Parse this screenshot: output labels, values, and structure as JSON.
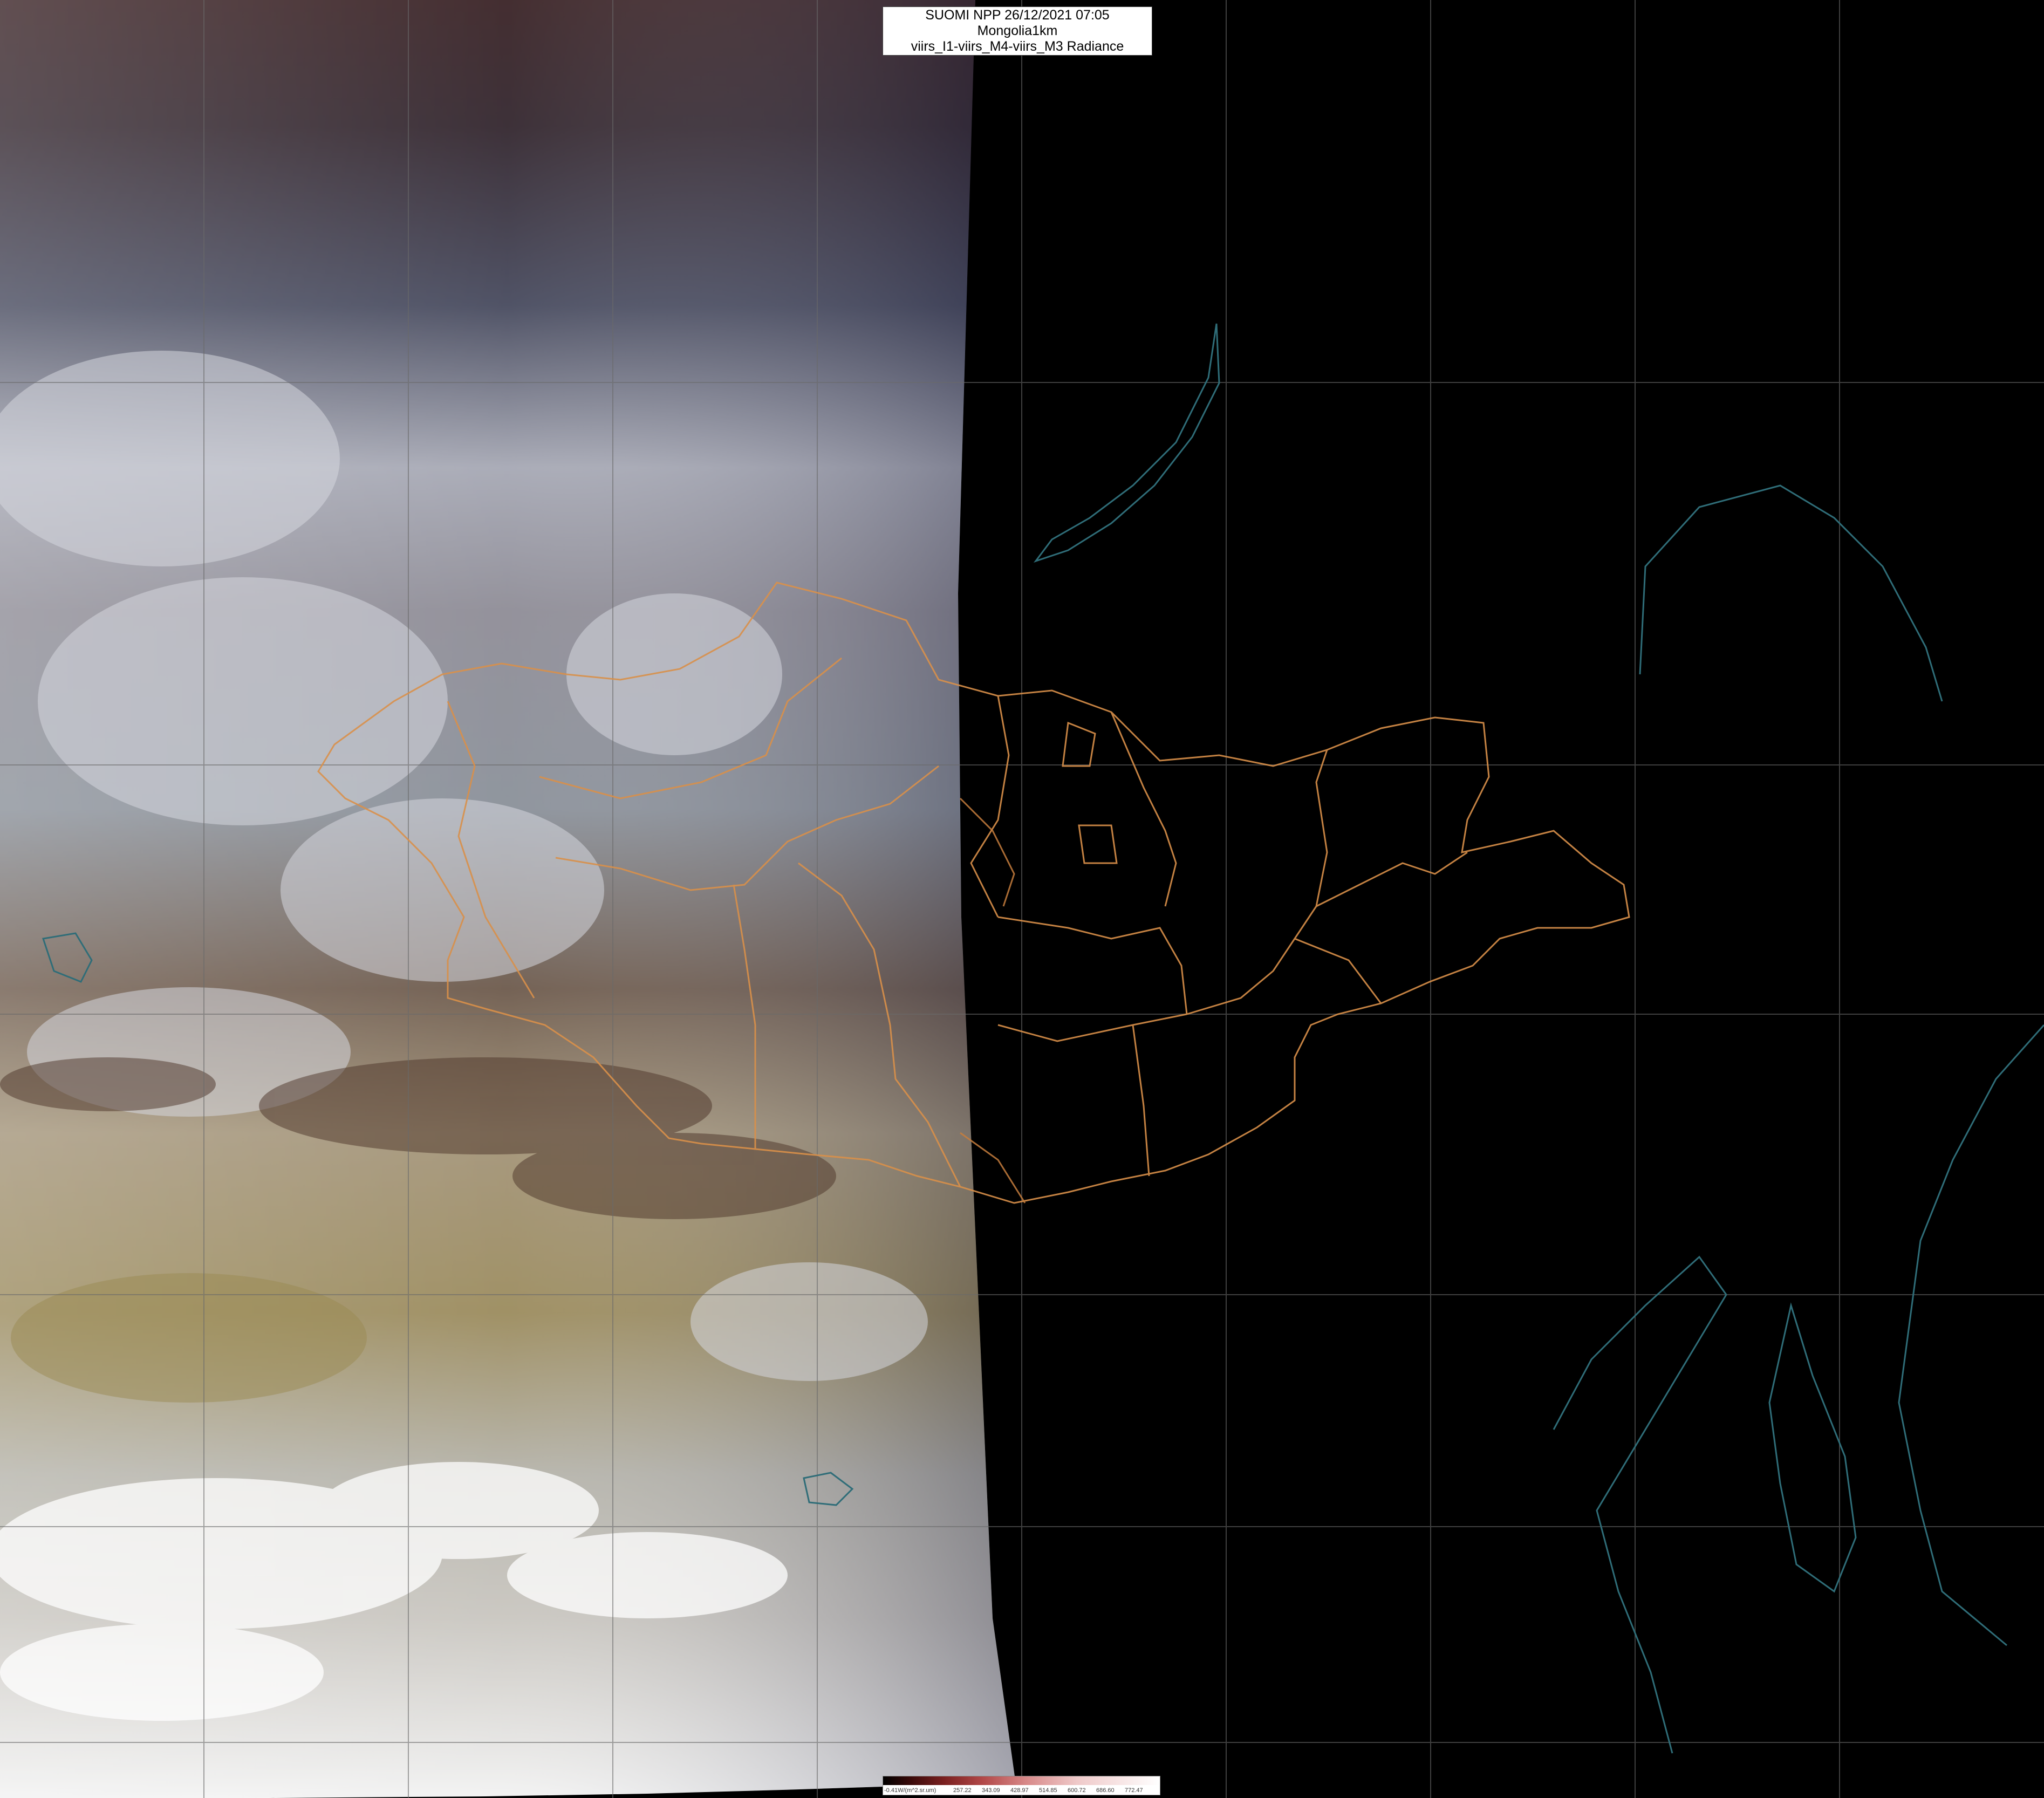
{
  "caption": {
    "line1": "SUOMI NPP 26/12/2021 07:05 Mongolia1km",
    "line2": "viirs_I1-viirs_M4-viirs_M3 Radiance"
  },
  "colorbar": {
    "unit_label": "-0.41W/(m^2.sr.um)",
    "ticks": [
      "257.22",
      "343.09",
      "428.97",
      "514.85",
      "600.72",
      "686.60",
      "772.47"
    ]
  },
  "colors": {
    "admin_border": "#d9904a",
    "coastline": "#2f6d78",
    "graticule": "#6a6a6a",
    "night_side": "#000000"
  }
}
